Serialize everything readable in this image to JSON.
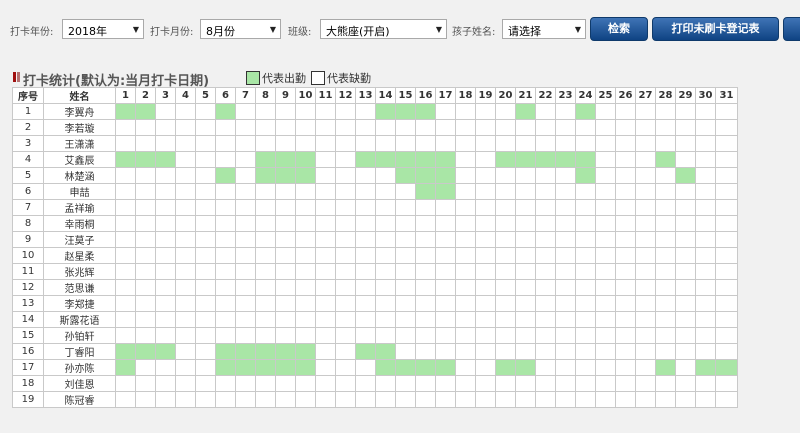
{
  "filters": {
    "year_label": "打卡年份:",
    "year_value": "2018年",
    "month_label": "打卡月份:",
    "month_value": "8月份",
    "class_label": "班级:",
    "class_value": "大熊座(开启)",
    "child_label": "孩子姓名:",
    "child_value": "请选择"
  },
  "buttons": {
    "search": "检索",
    "print": "打印未刷卡登记表"
  },
  "section": {
    "title": "打卡统计(默认为:当月打卡日期)",
    "legend_present": "代表出勤",
    "legend_absent": "代表缺勤"
  },
  "colors": {
    "present": "#a9e6a6",
    "button": "#1a4f8f"
  },
  "table": {
    "col_index": "序号",
    "col_name": "姓名",
    "days": 31,
    "rows": [
      {
        "no": "1",
        "name": "李翼舟",
        "present": [
          1,
          2,
          6,
          14,
          15,
          16,
          21,
          24
        ]
      },
      {
        "no": "2",
        "name": "李若璇",
        "present": []
      },
      {
        "no": "3",
        "name": "王潇潇",
        "present": []
      },
      {
        "no": "4",
        "name": "艾鑫辰",
        "present": [
          1,
          2,
          3,
          8,
          9,
          10,
          13,
          14,
          15,
          16,
          17,
          20,
          21,
          22,
          23,
          24,
          28
        ]
      },
      {
        "no": "5",
        "name": "林楚涵",
        "present": [
          6,
          8,
          9,
          10,
          15,
          16,
          17,
          24,
          29
        ]
      },
      {
        "no": "6",
        "name": "申喆",
        "present": [
          16,
          17
        ]
      },
      {
        "no": "7",
        "name": "孟祥瑜",
        "present": []
      },
      {
        "no": "8",
        "name": "幸雨桐",
        "present": []
      },
      {
        "no": "9",
        "name": "汪莫子",
        "present": []
      },
      {
        "no": "10",
        "name": "赵星柔",
        "present": []
      },
      {
        "no": "11",
        "name": "张兆辉",
        "present": []
      },
      {
        "no": "12",
        "name": "范思谦",
        "present": []
      },
      {
        "no": "13",
        "name": "李郑捷",
        "present": []
      },
      {
        "no": "14",
        "name": "斯露花语",
        "present": []
      },
      {
        "no": "15",
        "name": "孙铂轩",
        "present": []
      },
      {
        "no": "16",
        "name": "丁睿阳",
        "present": [
          1,
          2,
          3,
          6,
          7,
          8,
          9,
          10,
          13,
          14
        ]
      },
      {
        "no": "17",
        "name": "孙亦陈",
        "present": [
          1,
          6,
          7,
          8,
          9,
          10,
          14,
          15,
          16,
          17,
          20,
          21,
          28,
          30,
          31
        ]
      },
      {
        "no": "18",
        "name": "刘佳恩",
        "present": []
      },
      {
        "no": "19",
        "name": "陈冠睿",
        "present": []
      }
    ]
  }
}
